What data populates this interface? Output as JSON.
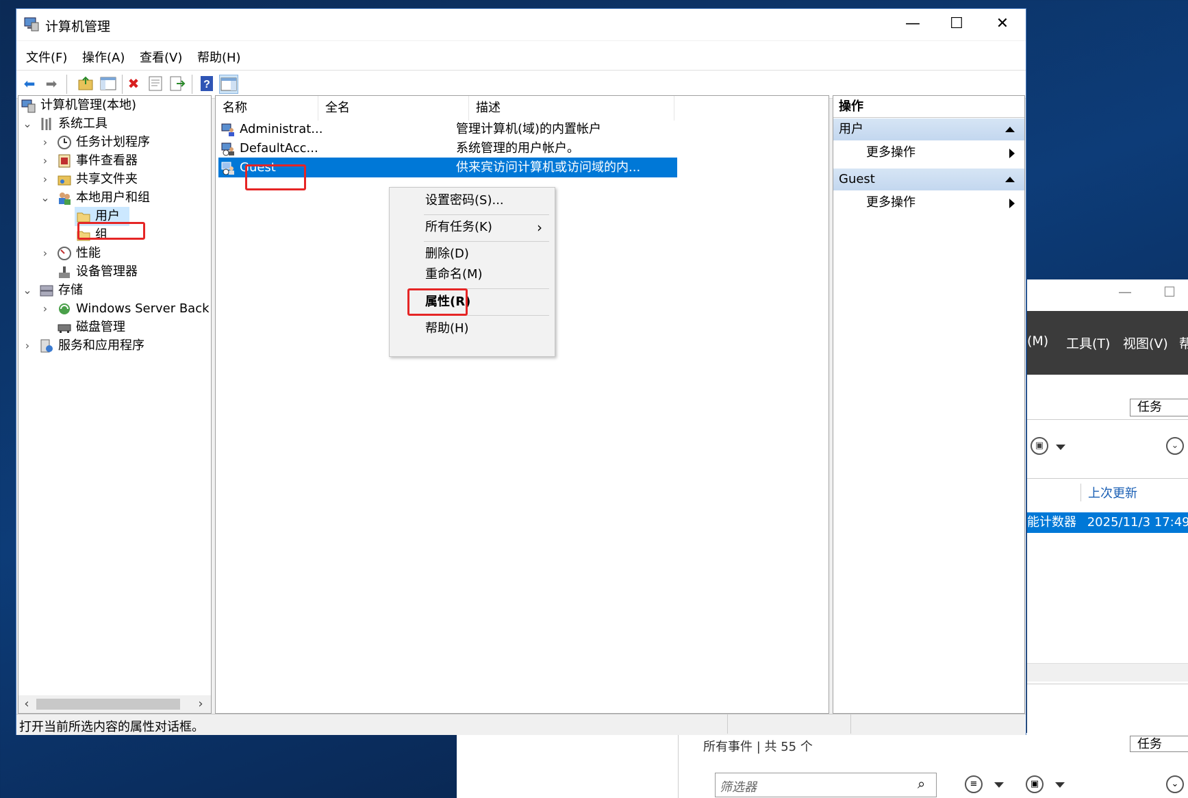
{
  "window": {
    "title": "计算机管理",
    "minimize_glyph": "—",
    "maximize_glyph": "☐",
    "close_glyph": "✕"
  },
  "menubar": [
    "文件(F)",
    "操作(A)",
    "查看(V)",
    "帮助(H)"
  ],
  "toolbar_icons": [
    "back-icon",
    "forward-icon",
    "up-folder-icon",
    "show-hide-tree-icon",
    "delete-icon",
    "properties-icon",
    "export-list-icon",
    "help-icon",
    "show-hide-action-pane-icon"
  ],
  "tree": {
    "root": "计算机管理(本地)",
    "system_tools": "系统工具",
    "task_scheduler": "任务计划程序",
    "event_viewer": "事件查看器",
    "shared_folders": "共享文件夹",
    "local_users_groups": "本地用户和组",
    "users": "用户",
    "groups": "组",
    "performance": "性能",
    "device_manager": "设备管理器",
    "storage": "存储",
    "windows_server_backup": "Windows Server Back",
    "disk_management": "磁盘管理",
    "services_apps": "服务和应用程序"
  },
  "list": {
    "headers": [
      "名称",
      "全名",
      "描述"
    ],
    "rows": [
      {
        "name": "Administrat...",
        "fullname": "",
        "description": "管理计算机(域)的内置帐户",
        "selected": false
      },
      {
        "name": "DefaultAcc...",
        "fullname": "",
        "description": "系统管理的用户帐户。",
        "selected": false
      },
      {
        "name": "Guest",
        "fullname": "",
        "description": "供来宾访问计算机或访问域的内...",
        "selected": true
      }
    ]
  },
  "context_menu": {
    "set_password": "设置密码(S)...",
    "all_tasks": "所有任务(K)",
    "delete": "删除(D)",
    "rename": "重命名(M)",
    "properties": "属性(R)",
    "help": "帮助(H)"
  },
  "actions": {
    "header": "操作",
    "group1": "用户",
    "group1_more": "更多操作",
    "group2": "Guest",
    "group2_more": "更多操作"
  },
  "status_text": "打开当前所选内容的属性对话框。",
  "background_window": {
    "menu_items": [
      "(M)",
      "工具(T)",
      "视图(V)",
      "帮"
    ],
    "task_button": "任务",
    "last_update_header": "上次更新",
    "row_left": "能计数器",
    "row_time": "2025/11/3 17:49:",
    "events_summary": "所有事件 | 共 55 个",
    "task_button2": "任务",
    "filter_placeholder": "筛选器",
    "minimize_glyph": "—",
    "maximize_glyph": "☐"
  },
  "colors": {
    "selection": "#0078d7",
    "highlight_box": "#e52525",
    "action_group_bg": "#c9dbf0"
  }
}
